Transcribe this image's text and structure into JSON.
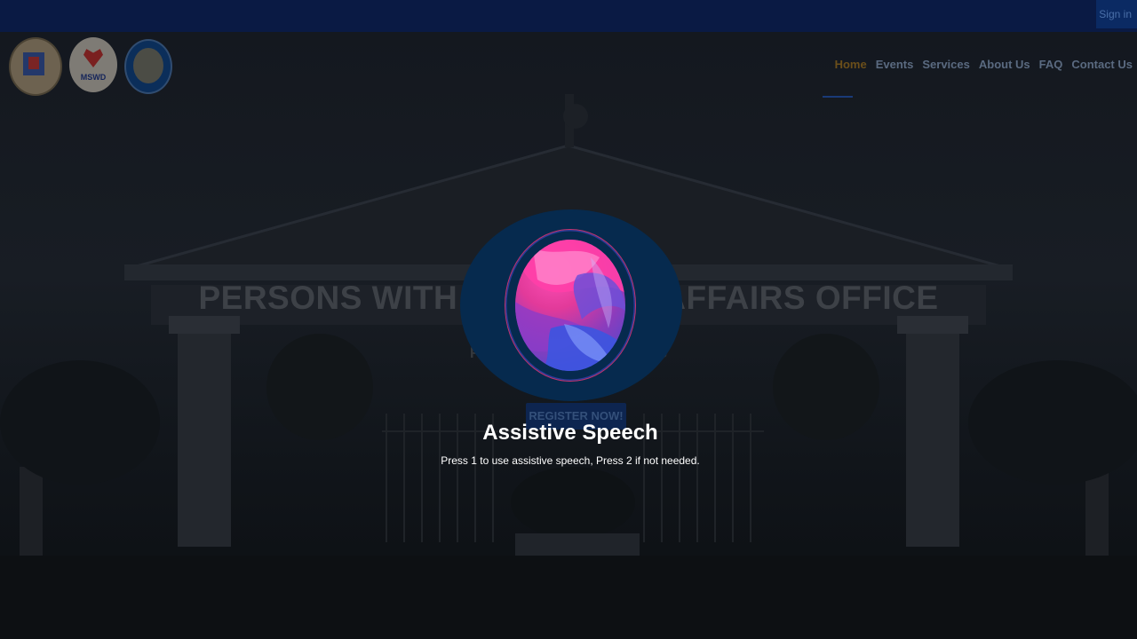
{
  "topbar": {
    "signin_label": "Sign in"
  },
  "header": {
    "logos": [
      {
        "name": "city-seal-logo"
      },
      {
        "name": "mswd-logo",
        "text": "MSWD"
      },
      {
        "name": "pwd-logo"
      }
    ],
    "nav": [
      {
        "label": "Home",
        "active": true
      },
      {
        "label": "Events",
        "active": false
      },
      {
        "label": "Services",
        "active": false
      },
      {
        "label": "About Us",
        "active": false
      },
      {
        "label": "FAQ",
        "active": false
      },
      {
        "label": "Contact Us",
        "active": false
      }
    ]
  },
  "hero": {
    "title": "PERSONS WITH DISABILITY AFFAIRS OFFICE",
    "subtitle": "F                                        AS",
    "register_label": "REGISTER NOW!"
  },
  "assistive": {
    "title": "Assistive Speech",
    "description": "Press 1 to use assistive speech, Press 2 if not needed."
  },
  "colors": {
    "topbar": "#0a1a44",
    "active_nav": "#6b4f1a",
    "modal_circle": "#062a4e",
    "orb_pink": "#e23a9a",
    "orb_blue": "#3a4cd4"
  }
}
